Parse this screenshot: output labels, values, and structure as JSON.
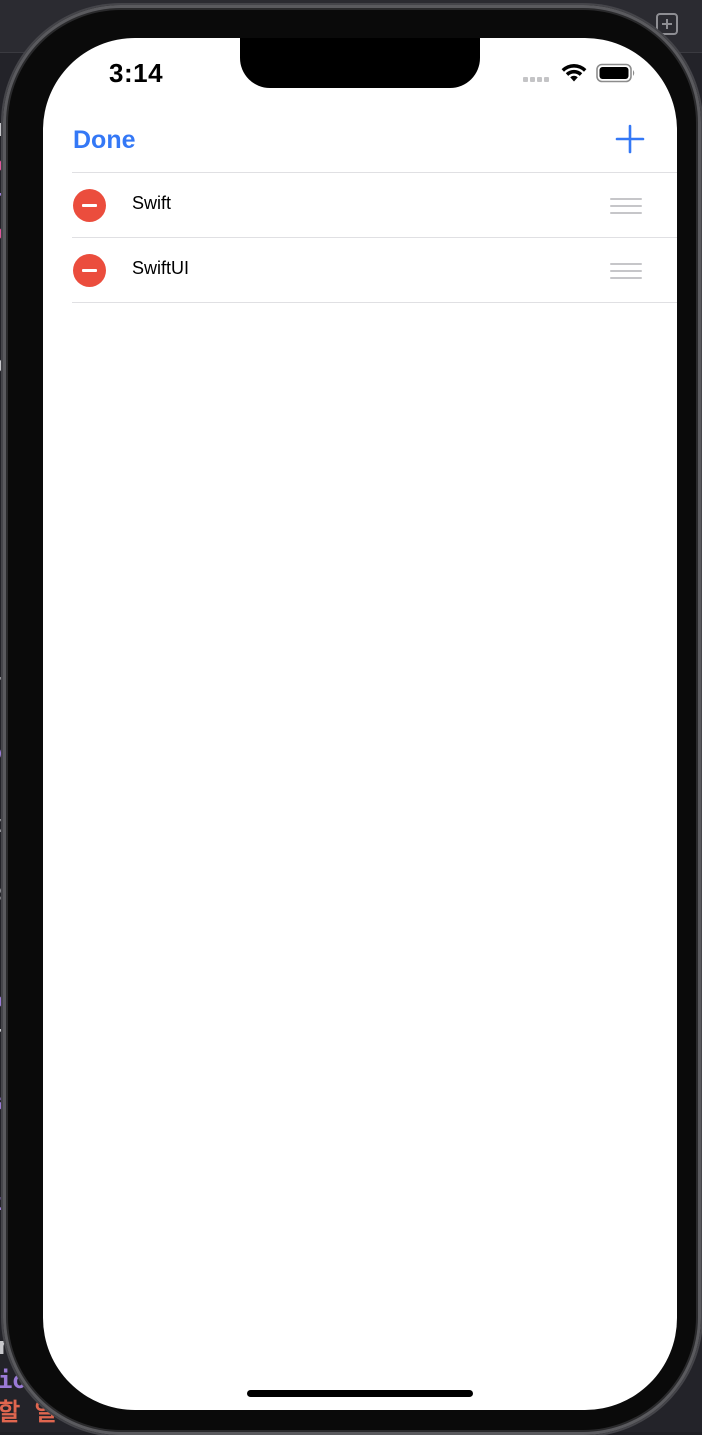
{
  "status_bar": {
    "time": "3:14"
  },
  "nav_bar": {
    "done_label": "Done",
    "add_icon": "plus-icon"
  },
  "list": {
    "items": [
      {
        "label": "Swift",
        "delete_icon": "minus-circle-icon",
        "reorder_icon": "reorder-grip-icon"
      },
      {
        "label": "SwiftUI",
        "delete_icon": "minus-circle-icon",
        "reorder_icon": "reorder-grip-icon"
      }
    ]
  },
  "colors": {
    "accent": "#3478f6",
    "destructive": "#eb4d3d",
    "separator": "#e0e0e3",
    "reorder_grip": "#c6c6c9"
  }
}
